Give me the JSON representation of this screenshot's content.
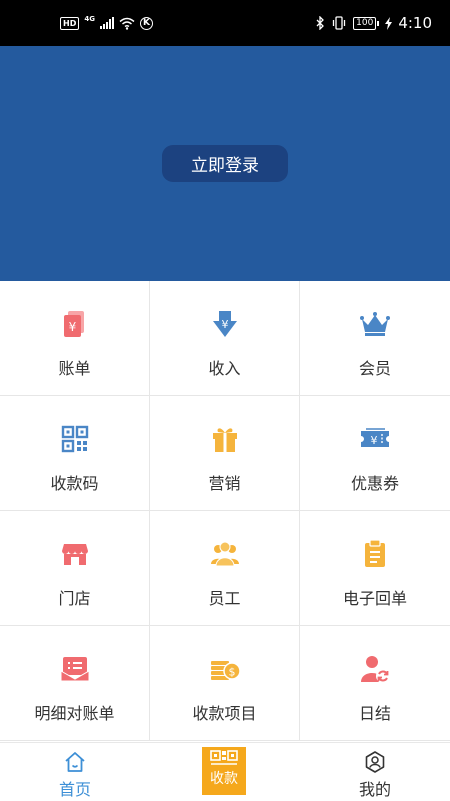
{
  "status_bar": {
    "hd": "HD",
    "network": "4G",
    "time": "4:10",
    "battery": "100"
  },
  "header": {
    "login_label": "立即登录",
    "bg_color": "#245a9e",
    "button_color": "#1c4280"
  },
  "grid": [
    {
      "label": "账单",
      "icon": "bill-icon",
      "color": "#f06b6f"
    },
    {
      "label": "收入",
      "icon": "income-icon",
      "color": "#4a86c6"
    },
    {
      "label": "会员",
      "icon": "crown-icon",
      "color": "#4a86c6"
    },
    {
      "label": "收款码",
      "icon": "qr-code-icon",
      "color": "#4a86c6"
    },
    {
      "label": "营销",
      "icon": "gift-icon",
      "color": "#f5b43c"
    },
    {
      "label": "优惠券",
      "icon": "coupon-icon",
      "color": "#4a86c6"
    },
    {
      "label": "门店",
      "icon": "store-icon",
      "color": "#f06b6f"
    },
    {
      "label": "员工",
      "icon": "staff-icon",
      "color": "#f5b43c"
    },
    {
      "label": "电子回单",
      "icon": "clipboard-icon",
      "color": "#f5b43c"
    },
    {
      "label": "明细对账单",
      "icon": "statement-icon",
      "color": "#f06b6f"
    },
    {
      "label": "收款项目",
      "icon": "coins-icon",
      "color": "#f5b43c"
    },
    {
      "label": "日结",
      "icon": "daily-settle-icon",
      "color": "#f06b6f"
    }
  ],
  "bottom_nav": {
    "home_label": "首页",
    "collect_label": "收款",
    "mine_label": "我的",
    "active_color": "#3d8fd6",
    "collect_color": "#f5a81c"
  }
}
